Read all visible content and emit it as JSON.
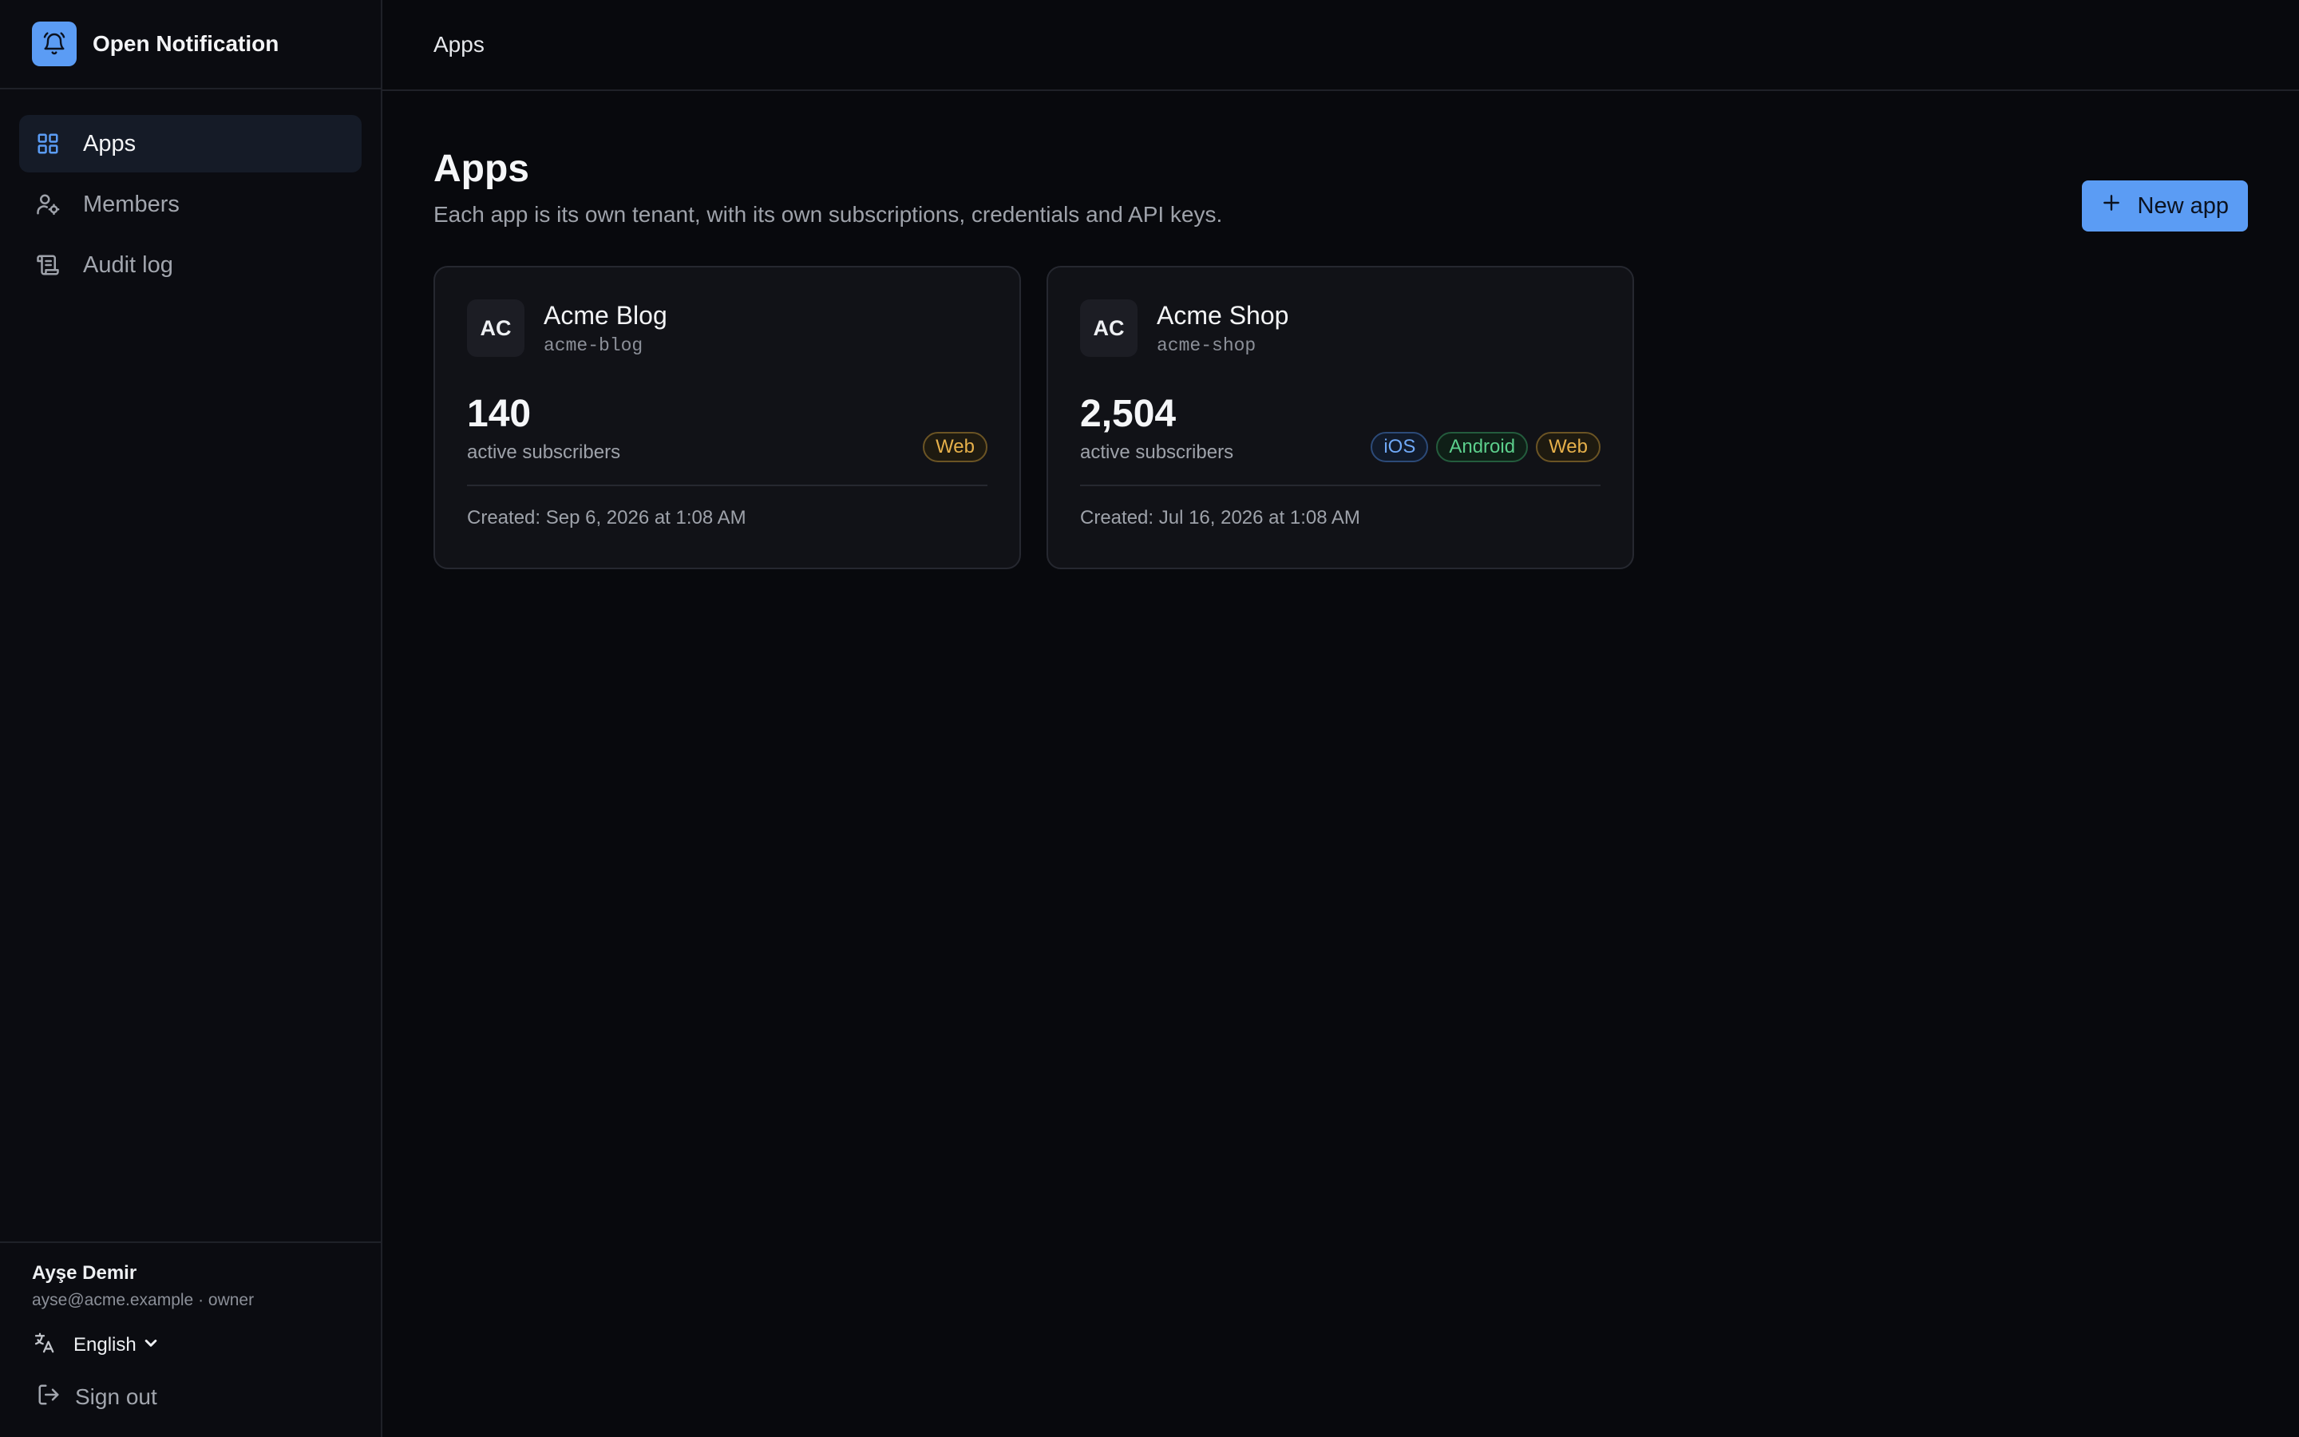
{
  "brand": {
    "name": "Open Notification"
  },
  "sidebar": {
    "items": [
      {
        "label": "Apps",
        "icon": "grid-icon",
        "active": true
      },
      {
        "label": "Members",
        "icon": "users-icon",
        "active": false
      },
      {
        "label": "Audit log",
        "icon": "scroll-icon",
        "active": false
      }
    ]
  },
  "user": {
    "name": "Ayşe Demir",
    "meta": "ayse@acme.example · owner",
    "language": "English",
    "sign_out": "Sign out"
  },
  "topbar": {
    "breadcrumb": "Apps"
  },
  "page": {
    "title": "Apps",
    "subtitle": "Each app is its own tenant, with its own subscriptions, credentials and API keys.",
    "new_app_label": "New app"
  },
  "apps": [
    {
      "initials": "AC",
      "name": "Acme Blog",
      "slug": "acme-blog",
      "subscribers": "140",
      "subscribers_label": "active subscribers",
      "platforms": [
        "Web"
      ],
      "created": "Created: Sep 6, 2026 at 1:08 AM"
    },
    {
      "initials": "AC",
      "name": "Acme Shop",
      "slug": "acme-shop",
      "subscribers": "2,504",
      "subscribers_label": "active subscribers",
      "platforms": [
        "iOS",
        "Android",
        "Web"
      ],
      "created": "Created: Jul 16, 2026 at 1:08 AM"
    }
  ],
  "colors": {
    "accent": "#5b9cf4",
    "background": "#08090d",
    "sidebar": "#0b0c11",
    "card": "#111217",
    "web_badge": "#e6b04a",
    "ios_badge": "#6fa8f6",
    "android_badge": "#5ccf8c"
  }
}
